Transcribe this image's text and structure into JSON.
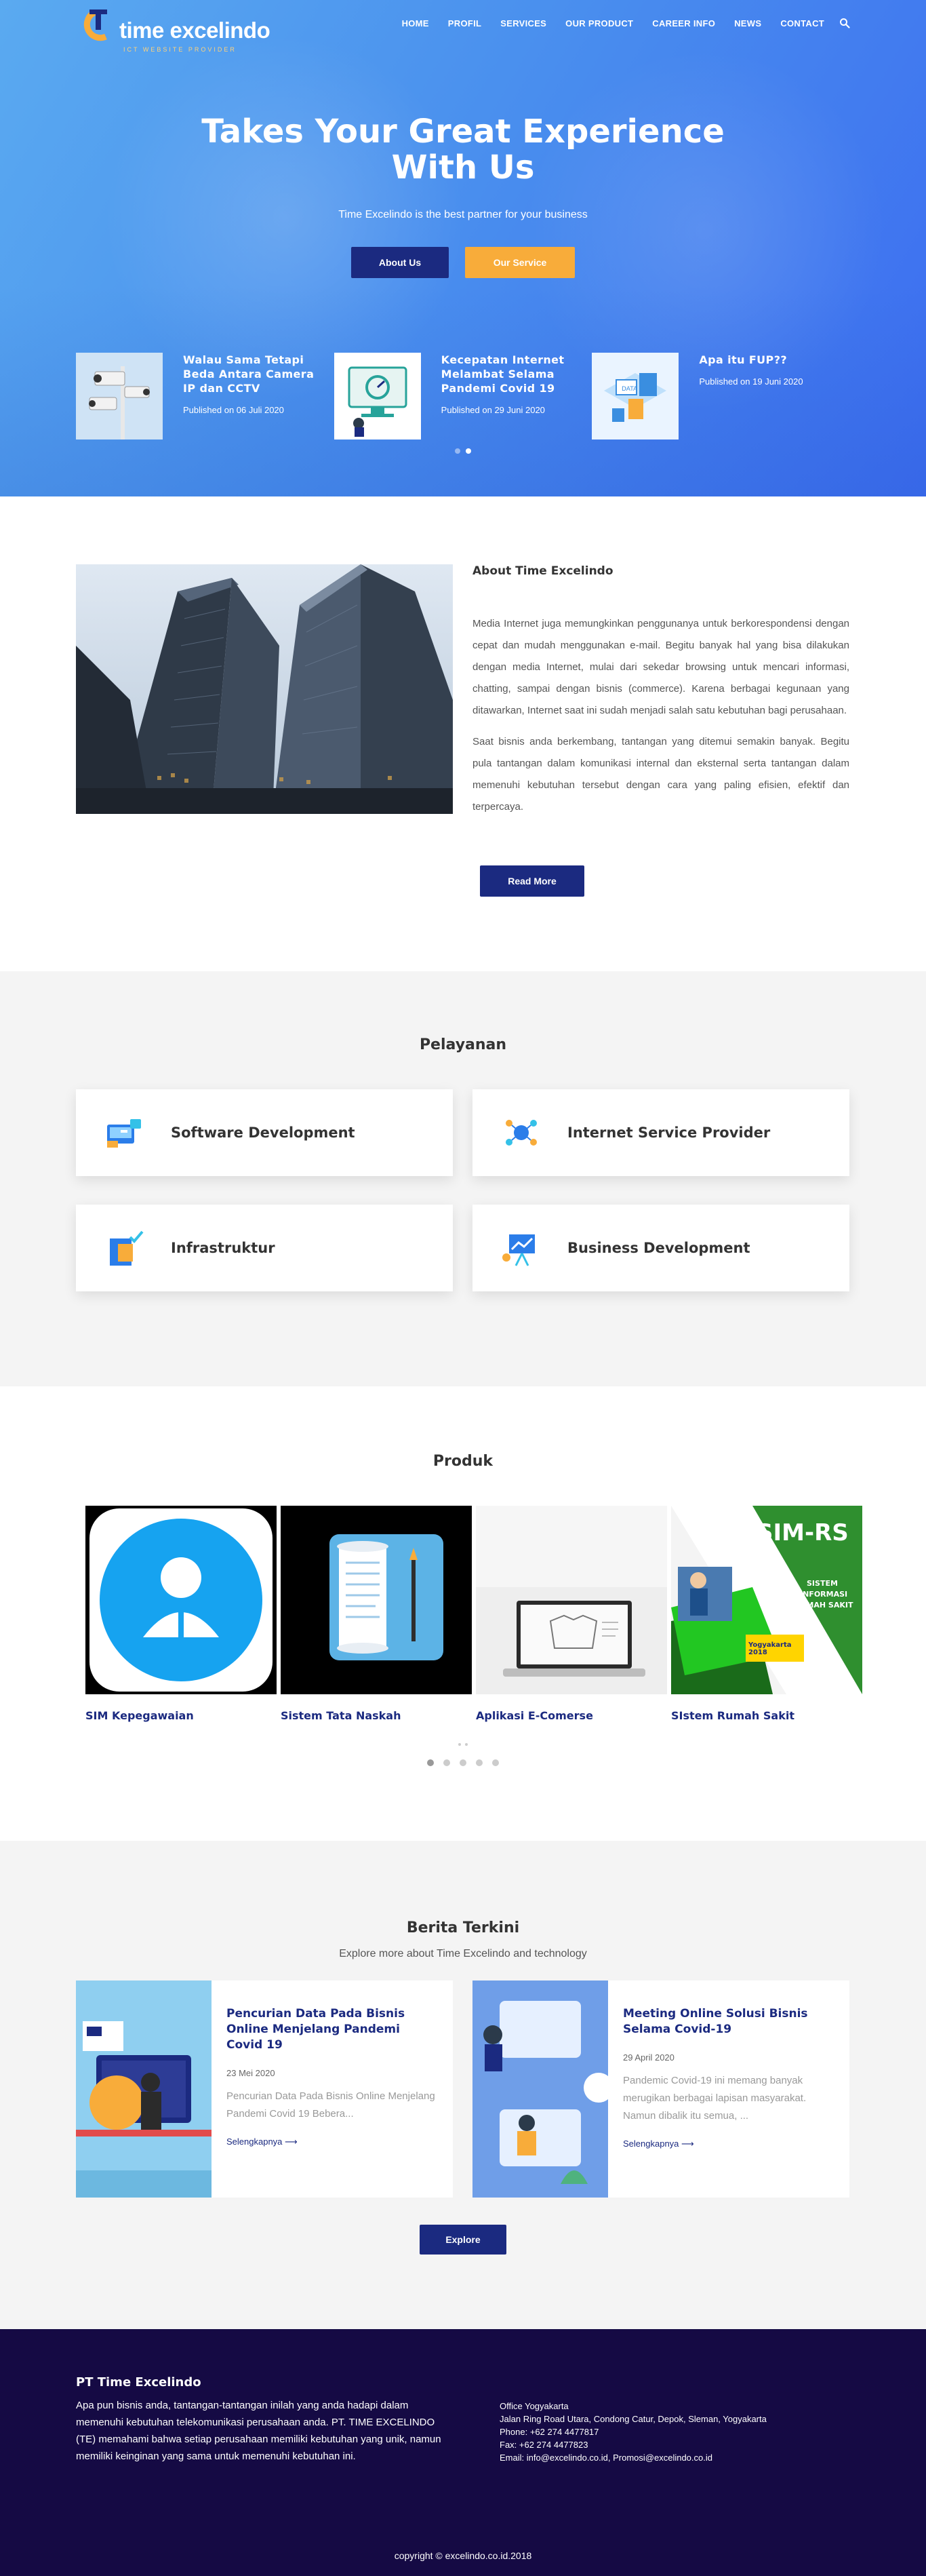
{
  "brand": {
    "name": "time excelindo",
    "tagline": "ICT WEBSITE PROVIDER",
    "colors": {
      "navy": "#1b2a80",
      "orange": "#f8ac3a",
      "heroBlue": "#4a90ee",
      "footer": "#150a44"
    }
  },
  "nav": {
    "items": [
      "HOME",
      "PROFIL",
      "SERVICES",
      "OUR PRODUCT",
      "CAREER INFO",
      "NEWS",
      "CONTACT"
    ],
    "search_icon": "search-icon"
  },
  "hero": {
    "title_line1": "Takes Your Great Experience",
    "title_line2": "With Us",
    "subtitle": "Time Excelindo is the best partner for your business",
    "btn_about": "About Us",
    "btn_service": "Our Service",
    "posts": [
      {
        "title": "Walau Sama Tetapi Beda Antara Camera IP dan CCTV",
        "date": "Published on 06 Juli 2020",
        "image": "cctv-camera-image"
      },
      {
        "title": "Kecepatan Internet Melambat Selama Pandemi Covid 19",
        "date": "Published on 29 Juni 2020",
        "image": "internet-speed-illustration"
      },
      {
        "title": "Apa itu FUP??",
        "date": "Published on 19 Juni 2020",
        "image": "data-fup-illustration"
      }
    ],
    "dots": 2,
    "active_dot": 1
  },
  "about": {
    "title": "About Time Excelindo",
    "para1": "Media Internet juga memungkinkan penggunanya untuk berkorespondensi dengan cepat dan mudah menggunakan e-mail. Begitu banyak hal yang bisa dilakukan dengan media Internet, mulai dari sekedar browsing untuk mencari informasi, chatting, sampai dengan bisnis (commerce). Karena berbagai kegunaan yang ditawarkan, Internet saat ini sudah menjadi salah satu kebutuhan bagi perusahaan.",
    "para2": "Saat bisnis anda berkembang, tantangan yang ditemui semakin banyak. Begitu pula tantangan dalam komunikasi internal dan eksternal serta tantangan dalam memenuhi kebutuhan tersebut dengan cara yang paling efisien, efektif dan terpercaya.",
    "btn": "Read More"
  },
  "services": {
    "title": "Pelayanan",
    "items": [
      {
        "name": "Software Development",
        "icon": "software-development-icon"
      },
      {
        "name": "Internet Service Provider",
        "icon": "internet-service-provider-icon"
      },
      {
        "name": "Infrastruktur",
        "icon": "infrastruktur-icon"
      },
      {
        "name": "Business Development",
        "icon": "business-development-icon"
      }
    ]
  },
  "products": {
    "title": "Produk",
    "items": [
      {
        "name": "SIM Kepegawaian",
        "image": "user-profile-icon"
      },
      {
        "name": "Sistem Tata Naskah",
        "image": "document-scroll-icon"
      },
      {
        "name": "Aplikasi E-Comerse",
        "image": "laptop-image"
      },
      {
        "name": "SIstem Rumah Sakit",
        "image": "sim-rs-poster",
        "poster_title": "SIM-RS",
        "poster_lines": [
          "SISTEM",
          "INFORMASI",
          "RUMAH SAKIT"
        ],
        "poster_badge": "Yogyakarta 2018"
      }
    ],
    "dots": 5,
    "active_dot": 0
  },
  "news": {
    "title": "Berita Terkini",
    "subtitle": "Explore more about Time Excelindo and technology",
    "items": [
      {
        "title": "Pencurian Data Pada Bisnis Online Menjelang Pandemi Covid 19",
        "date": "23 Mei 2020",
        "excerpt": "Pencurian Data Pada Bisnis Online Menjelang  Pandemi Covid 19     Bebera...",
        "more": "Selengkapnya ⟶",
        "image": "data-theft-illustration"
      },
      {
        "title": "Meeting Online Solusi Bisnis Selama Covid-19",
        "date": "29 April 2020",
        "excerpt": "Pandemic Covid-19 ini memang banyak merugikan berbagai lapisan masyarakat. Namun dibalik itu semua, ...",
        "more": "Selengkapnya ⟶",
        "image": "online-meeting-illustration"
      }
    ],
    "btn": "Explore"
  },
  "footer": {
    "title": "PT Time Excelindo",
    "description": "Apa pun bisnis anda, tantangan-tantangan inilah yang anda hadapi dalam memenuhi kebutuhan telekomunikasi perusahaan anda. PT. TIME EXCELINDO (TE) memahami bahwa setiap perusahaan memiliki kebutuhan yang unik, namun memiliki keinginan yang sama untuk memenuhi kebutuhan ini.",
    "office": "Office Yogyakarta",
    "address": "Jalan Ring Road Utara, Condong Catur, Depok, Sleman, Yogyakarta",
    "phone": "Phone: +62 274 4477817",
    "fax": "Fax: +62 274 4477823",
    "email": "Email: info@excelindo.co.id, Promosi@excelindo.co.id",
    "copyright": "copyright © excelindo.co.id.2018"
  }
}
